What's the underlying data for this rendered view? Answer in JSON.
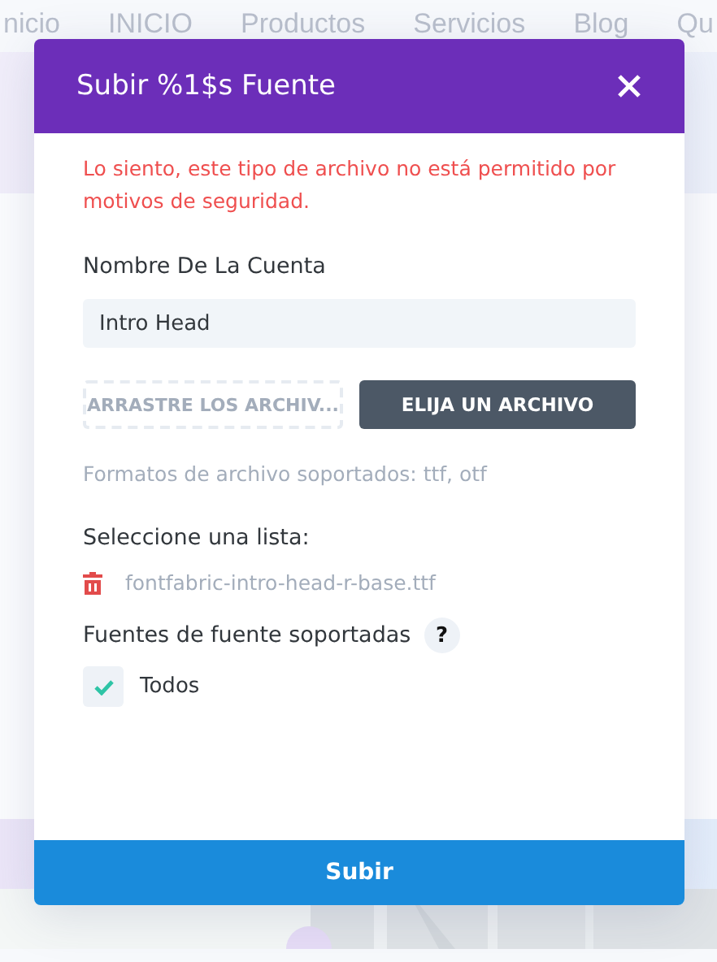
{
  "background": {
    "nav": [
      "nicio",
      "INICIO",
      "Productos",
      "Servicios",
      "Blog",
      "Qu"
    ],
    "kind": "picture"
  },
  "modal": {
    "title": "Subir %1$s Fuente",
    "error": "Lo siento, este tipo de archivo no está permitido por motivos de seguridad.",
    "name_label": "Nombre De La Cuenta",
    "name_value": "Intro Head",
    "drop_zone": "ARRASTRE LOS ARCHIV...",
    "choose_button": "ELIJA UN ARCHIVO",
    "formats": "Formatos de archivo soportados: ttf, otf",
    "list_label": "Seleccione una lista:",
    "files": [
      "fontfabric-intro-head-r-base.ttf"
    ],
    "support_label": "Fuentes de fuente soportadas",
    "help": "?",
    "options": [
      {
        "label": "Todos",
        "checked": true
      }
    ],
    "submit": "Subir"
  }
}
